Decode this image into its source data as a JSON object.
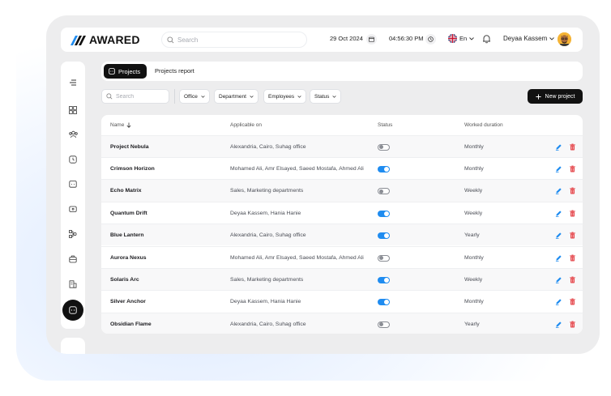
{
  "app": {
    "logo_text": "AWARED"
  },
  "header": {
    "search_placeholder": "Search",
    "date": "29 Oct 2024",
    "time": "04:56:30 PM",
    "language": "En",
    "user_name": "Deyaa Kassem"
  },
  "sidebar": {
    "icons": [
      "collapse-icon",
      "dashboard-icon",
      "users-icon",
      "clock-icon",
      "calendar-icon",
      "wallet-icon",
      "workflow-icon",
      "briefcase-icon",
      "building-icon",
      "projects-icon"
    ]
  },
  "tabs": {
    "active": "Projects",
    "other": "Projects report"
  },
  "filters": {
    "search_placeholder": "Search",
    "office": "Office",
    "department": "Department",
    "employees": "Employees",
    "status": "Status",
    "new_project": "New project"
  },
  "table": {
    "headers": {
      "name": "Name",
      "applicable": "Applicable on",
      "status": "Status",
      "duration": "Worked duration"
    },
    "rows": [
      {
        "name": "Project Nebula",
        "applicable": "Alexandria, Cairo, Suhag office",
        "status": false,
        "duration": "Monthly"
      },
      {
        "name": "Crimson Horizon",
        "applicable": "Mohamed Ali, Amr Elsayed, Saeed Mostafa, Ahmed Ali",
        "status": true,
        "duration": "Monthly"
      },
      {
        "name": "Echo Matrix",
        "applicable": "Sales, Marketing departments",
        "status": false,
        "duration": "Weekly"
      },
      {
        "name": "Quantum Drift",
        "applicable": "Deyaa Kassem, Hania Hanie",
        "status": true,
        "duration": "Weekly"
      },
      {
        "name": "Blue Lantern",
        "applicable": "Alexandria, Cairo, Suhag office",
        "status": true,
        "duration": "Yearly"
      },
      {
        "name": "Aurora Nexus",
        "applicable": "Mohamed Ali, Amr Elsayed, Saeed Mostafa, Ahmed Ali",
        "status": false,
        "duration": "Monthly"
      },
      {
        "name": "Solaris Arc",
        "applicable": "Sales, Marketing departments",
        "status": true,
        "duration": "Weekly"
      },
      {
        "name": "Silver Anchor",
        "applicable": "Deyaa Kassem, Hania Hanie",
        "status": true,
        "duration": "Monthly"
      },
      {
        "name": "Obsidian Flame",
        "applicable": "Alexandria, Cairo, Suhag office",
        "status": false,
        "duration": "Yearly"
      }
    ]
  },
  "colors": {
    "accent": "#1f8cf0",
    "primary": "#111111",
    "danger": "#e5484d"
  }
}
